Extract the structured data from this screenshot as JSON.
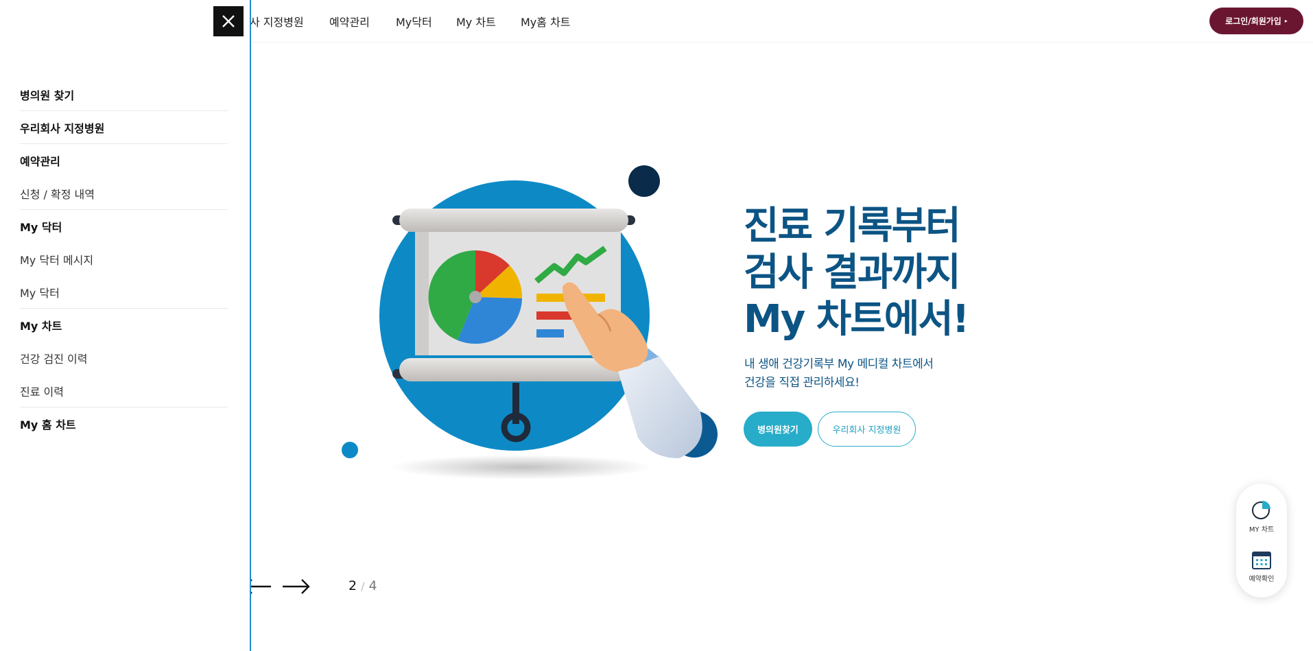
{
  "nav": {
    "items": [
      "사 지정병원",
      "예약관리",
      "My닥터",
      "My 차트",
      "My홈 차트"
    ],
    "login_label": "로그인/회원가입",
    "login_arrow": "▸"
  },
  "drawer": {
    "close_icon": "close-icon",
    "menu": [
      {
        "label": "병의원 찾기",
        "type": "head"
      },
      {
        "label": "우리회사 지정병원",
        "type": "head"
      },
      {
        "label": "예약관리",
        "type": "head"
      },
      {
        "label": "신청 / 확정 내역",
        "type": "sub"
      },
      {
        "label": "My 닥터",
        "type": "head"
      },
      {
        "label": "My 닥터 메시지",
        "type": "sub"
      },
      {
        "label": "My 닥터",
        "type": "sub"
      },
      {
        "label": "My 차트",
        "type": "head"
      },
      {
        "label": "건강 검진 이력",
        "type": "sub"
      },
      {
        "label": "진료 이력",
        "type": "sub"
      },
      {
        "label": "My 홈 차트",
        "type": "head"
      }
    ]
  },
  "hero": {
    "title_lines": [
      "진료 기록부터",
      "검사 결과까지",
      "My 차트에서!"
    ],
    "sub_lines": [
      "내 생애 건강기록부 My 메디컬 차트에서",
      "건강을 직접 관리하세요!"
    ],
    "primary_button": "병의원찾기",
    "secondary_button": "우리회사 지정병원"
  },
  "pager": {
    "current": "2",
    "separator": "/",
    "total": "4"
  },
  "quick": {
    "items": [
      {
        "label": "MY 차트",
        "icon": "pie-chart-icon"
      },
      {
        "label": "예약확인",
        "icon": "calendar-icon"
      }
    ]
  },
  "colors": {
    "brand_dark": "#0c5484",
    "accent": "#27acc9",
    "login": "#6b1630",
    "drawer_border": "#1d8fd0"
  }
}
